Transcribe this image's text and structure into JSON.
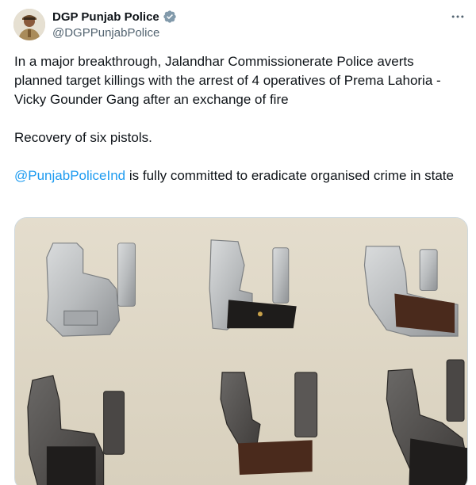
{
  "author": {
    "display_name": "DGP Punjab Police",
    "handle": "@DGPPunjabPolice",
    "verified": true,
    "verified_color": "#829aab",
    "avatar_icon": "police-officer-avatar"
  },
  "menu": {
    "icon": "more-horizontal-icon"
  },
  "tweet": {
    "paragraph_1": "In a major breakthrough, Jalandhar Commissionerate Police averts planned target killings with the arrest of 4 operatives of Prema Lahoria - Vicky Gounder Gang after an exchange of fire",
    "paragraph_2": "Recovery of six pistols.",
    "mention": "@PunjabPoliceInd",
    "paragraph_3_rest": " is fully committed to eradicate organised crime in state"
  },
  "media": {
    "kind": "photo",
    "subject": "recovered-pistols-photo"
  },
  "colors": {
    "text_primary": "#0f1419",
    "text_secondary": "#536471",
    "link": "#1d9bf0",
    "border": "#cfd9de"
  }
}
